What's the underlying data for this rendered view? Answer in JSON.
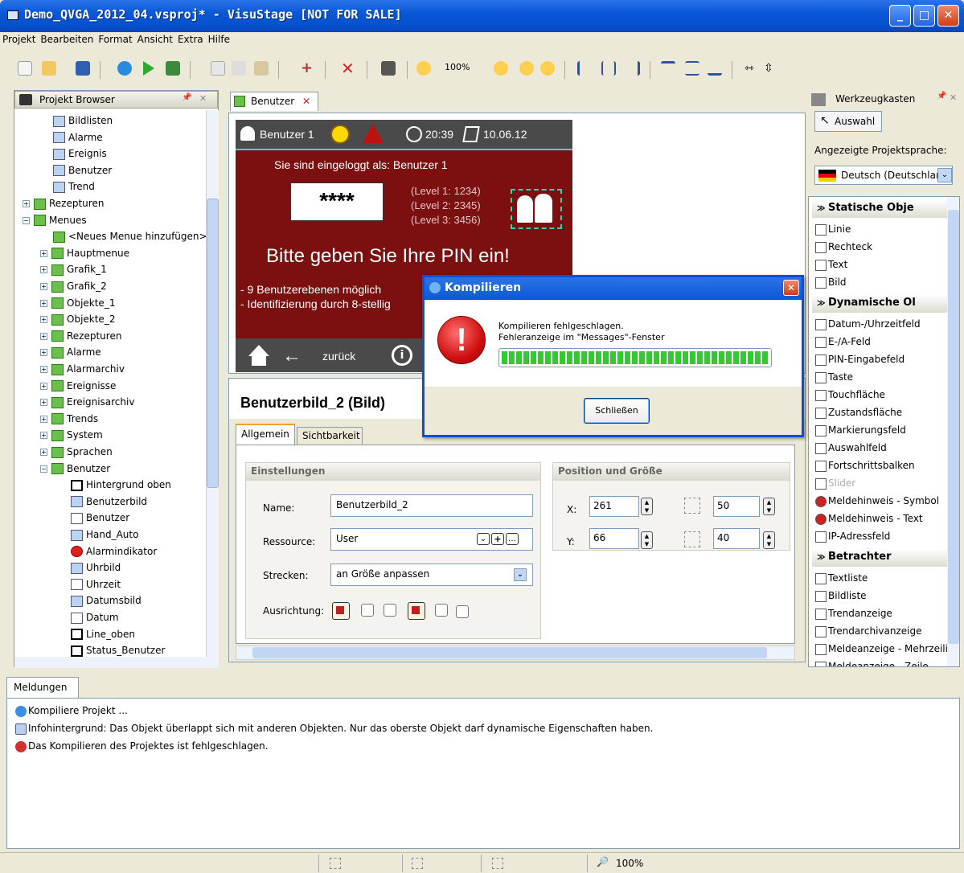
{
  "window": {
    "title": "Demo_QVGA_2012_04.vsproj* - VisuStage [NOT FOR SALE]"
  },
  "menu": [
    "Projekt",
    "Bearbeiten",
    "Format",
    "Ansicht",
    "Extra",
    "Hilfe"
  ],
  "toolbar": {
    "zoom": "100%"
  },
  "project_browser": {
    "title": "Projekt Browser",
    "items": [
      {
        "label": "Bildlisten",
        "level": 2,
        "icon": "list-icon"
      },
      {
        "label": "Alarme",
        "level": 2,
        "icon": "list-icon"
      },
      {
        "label": "Ereignis",
        "level": 2,
        "icon": "list-icon"
      },
      {
        "label": "Benutzer",
        "level": 2,
        "icon": "list-icon"
      },
      {
        "label": "Trend",
        "level": 2,
        "icon": "list-icon"
      },
      {
        "label": "Rezepturen",
        "level": 1,
        "expander": "+"
      },
      {
        "label": "Menues",
        "level": 1,
        "expander": "-"
      },
      {
        "label": "<Neues Menue hinzufügen>",
        "level": 2,
        "icon": "add-icon"
      },
      {
        "label": "Hauptmenue",
        "level": 2,
        "expander": "+"
      },
      {
        "label": "Grafik_1",
        "level": 2,
        "expander": "+"
      },
      {
        "label": "Grafik_2",
        "level": 2,
        "expander": "+"
      },
      {
        "label": "Objekte_1",
        "level": 2,
        "expander": "+"
      },
      {
        "label": "Objekte_2",
        "level": 2,
        "expander": "+"
      },
      {
        "label": "Rezepturen",
        "level": 2,
        "expander": "+"
      },
      {
        "label": "Alarme",
        "level": 2,
        "expander": "+"
      },
      {
        "label": "Alarmarchiv",
        "level": 2,
        "expander": "+"
      },
      {
        "label": "Ereignisse",
        "level": 2,
        "expander": "+"
      },
      {
        "label": "Ereignisarchiv",
        "level": 2,
        "expander": "+"
      },
      {
        "label": "Trends",
        "level": 2,
        "expander": "+"
      },
      {
        "label": "System",
        "level": 2,
        "expander": "+"
      },
      {
        "label": "Sprachen",
        "level": 2,
        "expander": "+"
      },
      {
        "label": "Benutzer",
        "level": 2,
        "expander": "-"
      },
      {
        "label": "Hintergrund oben",
        "level": 3,
        "icon": "rect-icon"
      },
      {
        "label": "Benutzerbild",
        "level": 3,
        "icon": "image-icon"
      },
      {
        "label": "Benutzer",
        "level": 3,
        "icon": "textlist-icon"
      },
      {
        "label": "Hand_Auto",
        "level": 3,
        "icon": "state-icon"
      },
      {
        "label": "Alarmindikator",
        "level": 3,
        "icon": "alarm-icon"
      },
      {
        "label": "Uhrbild",
        "level": 3,
        "icon": "image-icon"
      },
      {
        "label": "Uhrzeit",
        "level": 3,
        "icon": "time-icon"
      },
      {
        "label": "Datumsbild",
        "level": 3,
        "icon": "image-icon"
      },
      {
        "label": "Datum",
        "level": 3,
        "icon": "time-icon"
      },
      {
        "label": "Line_oben",
        "level": 3,
        "icon": "line-icon"
      },
      {
        "label": "Status_Benutzer",
        "level": 3,
        "icon": "text-icon"
      }
    ]
  },
  "editor": {
    "tab": "Benutzer",
    "screen": {
      "user": "Benutzer 1",
      "time": "20:39",
      "date": "10.06.12",
      "logged_in": "Sie sind eingeloggt als: Benutzer 1",
      "pin_mask": "****",
      "levels": [
        "(Level 1: 1234)",
        "(Level 2: 2345)",
        "(Level 3: 3456)"
      ],
      "headline": "Bitte geben Sie Ihre PIN ein!",
      "bullets": [
        "- 9 Benutzerebenen möglich",
        "- Identifizierung durch 8-stellig"
      ],
      "back": "zurück"
    }
  },
  "properties": {
    "title": "Benutzerbild_2 (Bild)",
    "tabs": [
      "Allgemein",
      "Sichtbarkeit"
    ],
    "settings_header": "Einstellungen",
    "name_label": "Name:",
    "name_value": "Benutzerbild_2",
    "resource_label": "Ressource:",
    "resource_value": "User",
    "stretch_label": "Strecken:",
    "stretch_value": "an Größe anpassen",
    "align_label": "Ausrichtung:",
    "pos_header": "Position und Größe",
    "x_label": "X:",
    "x_value": "261",
    "y_label": "Y:",
    "y_value": "66",
    "width_value": "50",
    "height_value": "40"
  },
  "toolbox": {
    "title": "Werkzeugkasten",
    "selection": "Auswahl",
    "lang_label": "Angezeigte Projektsprache:",
    "lang_value": "Deutsch (Deutschland)",
    "sections": [
      {
        "title": "Statische Obje",
        "items": [
          "Linie",
          "Rechteck",
          "Text",
          "Bild"
        ]
      },
      {
        "title": "Dynamische Ol",
        "items": [
          "Datum-/Uhrzeitfeld",
          "E-/A-Feld",
          "PIN-Eingabefeld",
          "Taste",
          "Touchfläche",
          "Zustandsfläche",
          "Markierungsfeld",
          "Auswahlfeld",
          "Fortschrittsbalken",
          "Slider",
          "Meldehinweis - Symbol",
          "Meldehinweis - Text",
          "IP-Adressfeld"
        ]
      },
      {
        "title": "Betrachter",
        "items": [
          "Textliste",
          "Bildliste",
          "Trendanzeige",
          "Trendarchivanzeige",
          "Meldeanzeige - Mehrzeilig",
          "Meldeanzeige - Zeile"
        ]
      }
    ]
  },
  "messages": {
    "tab": "Meldungen",
    "lines": [
      "Kompiliere Projekt ...",
      "Infohintergrund: Das Objekt überlappt sich mit anderen Objekten. Nur das oberste Objekt darf dynamische Eigenschaften haben.",
      "Das Kompilieren des Projektes ist fehlgeschlagen."
    ]
  },
  "status": {
    "zoom": "100%"
  },
  "dialog": {
    "title": "Kompilieren",
    "line1": "Kompilieren fehlgeschlagen.",
    "line2": "Fehleranzeige im \"Messages\"-Fenster",
    "progress": 1.0,
    "close_button": "Schließen"
  }
}
